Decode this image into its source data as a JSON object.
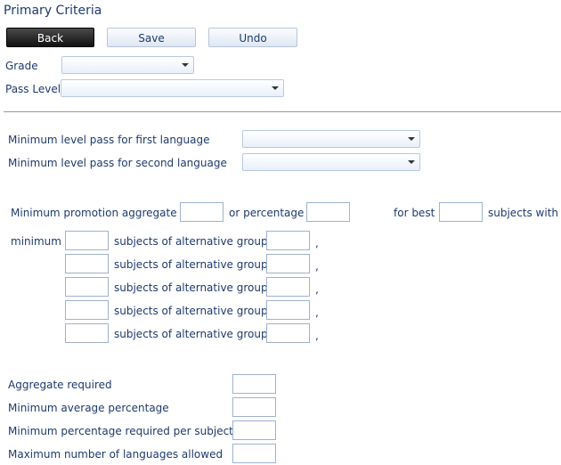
{
  "page": {
    "title": "Primary Criteria"
  },
  "toolbar": {
    "back_label": "Back",
    "save_label": "Save",
    "undo_label": "Undo"
  },
  "filters": {
    "grade_label": "Grade",
    "pass_level_label": "Pass Level",
    "grade_value": "",
    "pass_level_value": ""
  },
  "languages": {
    "first_label": "Minimum level pass for first language",
    "second_label": "Minimum level pass for second language",
    "first_value": "",
    "second_value": ""
  },
  "promotion": {
    "aggregate_label": "Minimum promotion aggregate",
    "or_percentage_label": "or percentage",
    "for_best_label": "for best",
    "subjects_with_label": "subjects with",
    "minimum_label": "minimum",
    "alt_group_label": "subjects of alternative group",
    "separator": ","
  },
  "requirements": {
    "aggregate_required": "Aggregate required",
    "min_average_percentage": "Minimum average percentage",
    "min_percentage_per_subject": "Minimum percentage required per subject",
    "max_languages_allowed": "Maximum number of languages allowed"
  },
  "icons": {
    "dropdown": "chevron-down-icon"
  }
}
